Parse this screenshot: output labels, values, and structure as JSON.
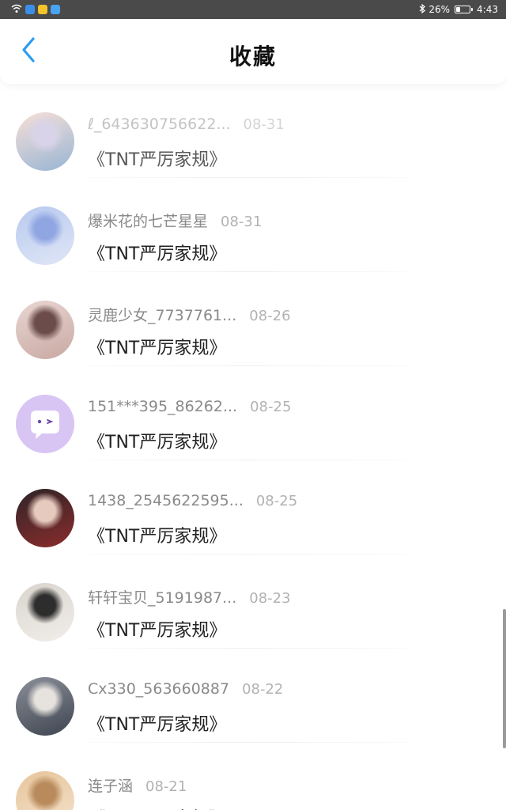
{
  "status_bar": {
    "battery": "26%",
    "battery_level": 0.26,
    "time": "4:43",
    "app_icon_colors": [
      "#3b8fe8",
      "#f2c32a",
      "#4aa3f0"
    ]
  },
  "header": {
    "title": "收藏",
    "back_icon": "chevron-left-icon",
    "accent_color": "#2b9cf2"
  },
  "favorites": [
    {
      "username": "ℓ_643630756622...",
      "date": "08-31",
      "title": "《TNT严厉家规》",
      "faded": true,
      "avatar_colors": [
        "#f6d9cf",
        "#cfc9e4",
        "#7fa3c9"
      ]
    },
    {
      "username": "爆米花的七芒星星",
      "date": "08-31",
      "title": "《TNT严厉家规》",
      "faded": false,
      "avatar_colors": [
        "#b8c9ef",
        "#8fa6e2",
        "#dfe6f6"
      ]
    },
    {
      "username": "灵鹿少女_7737761...",
      "date": "08-26",
      "title": "《TNT严厉家规》",
      "faded": false,
      "avatar_colors": [
        "#e9d6d2",
        "#6b4c4a",
        "#c9a9a3"
      ]
    },
    {
      "username": "151***395_86262...",
      "date": "08-25",
      "title": "《TNT严厉家规》",
      "faded": false,
      "avatar_colors": [
        "#d9c5f4",
        "#ffffff",
        "#6a48a8"
      ]
    },
    {
      "username": "1438_2545622595...",
      "date": "08-25",
      "title": "《TNT严厉家规》",
      "faded": false,
      "avatar_colors": [
        "#2d2427",
        "#e7cabe",
        "#8a2c2c"
      ]
    },
    {
      "username": "轩轩宝贝_5191987...",
      "date": "08-23",
      "title": "《TNT严厉家规》",
      "faded": false,
      "avatar_colors": [
        "#d9d4cd",
        "#2d2d2d",
        "#f1eeea"
      ]
    },
    {
      "username": "Cx330_563660887",
      "date": "08-22",
      "title": "《TNT严厉家规》",
      "faded": false,
      "avatar_colors": [
        "#8a8f99",
        "#e6e2dd",
        "#3f4550"
      ]
    },
    {
      "username": "连子涵",
      "date": "08-21",
      "title": "《TNT严厉家规》",
      "faded": false,
      "avatar_colors": [
        "#e7c49a",
        "#b88a5c",
        "#f4e3cc"
      ]
    }
  ]
}
